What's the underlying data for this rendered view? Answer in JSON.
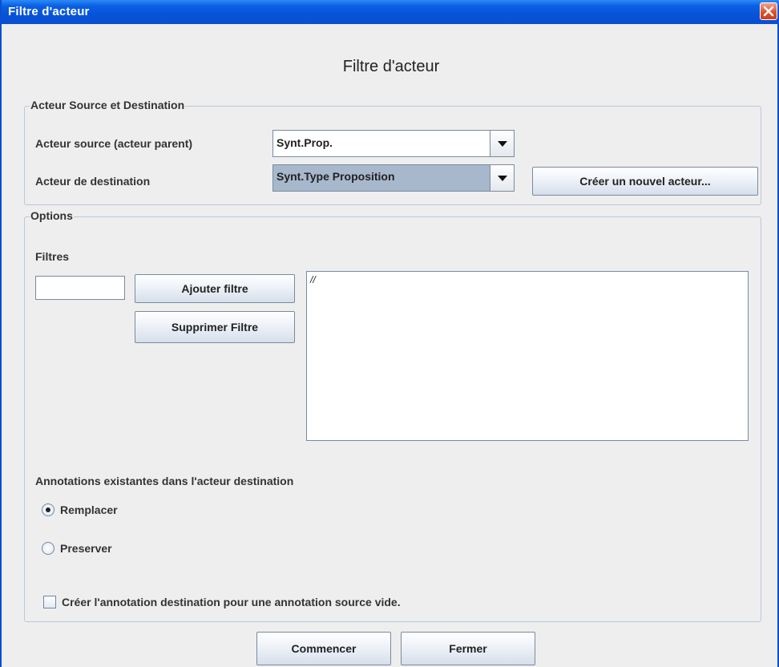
{
  "window": {
    "title": "Filtre d'acteur"
  },
  "dialog": {
    "heading": "Filtre d'acteur"
  },
  "source_dest": {
    "legend": "Acteur Source et Destination",
    "source_label": "Acteur source (acteur parent)",
    "source_value": "Synt.Prop.",
    "dest_label": "Acteur de destination",
    "dest_value": "Synt.Type Proposition",
    "create_button": "Créer un nouvel acteur..."
  },
  "options": {
    "legend": "Options",
    "filters_label": "Filtres",
    "filter_input_value": "",
    "add_filter_button": "Ajouter filtre",
    "remove_filter_button": "Supprimer Filtre",
    "filter_list_text": "//",
    "existing_annotations_label": "Annotations existantes dans l'acteur destination",
    "radio_replace": "Remplacer",
    "radio_preserve": "Preserver",
    "selected_radio": "Remplacer",
    "checkbox_label": "Créer l'annotation destination pour une annotation source vide.",
    "checkbox_checked": false
  },
  "footer": {
    "start_button": "Commencer",
    "close_button": "Fermer"
  },
  "colors": {
    "titlebar": "#0a4fd0",
    "close": "#e0512c",
    "window_bg": "#eeeeee",
    "selected_combo": "#a8b8cc"
  }
}
